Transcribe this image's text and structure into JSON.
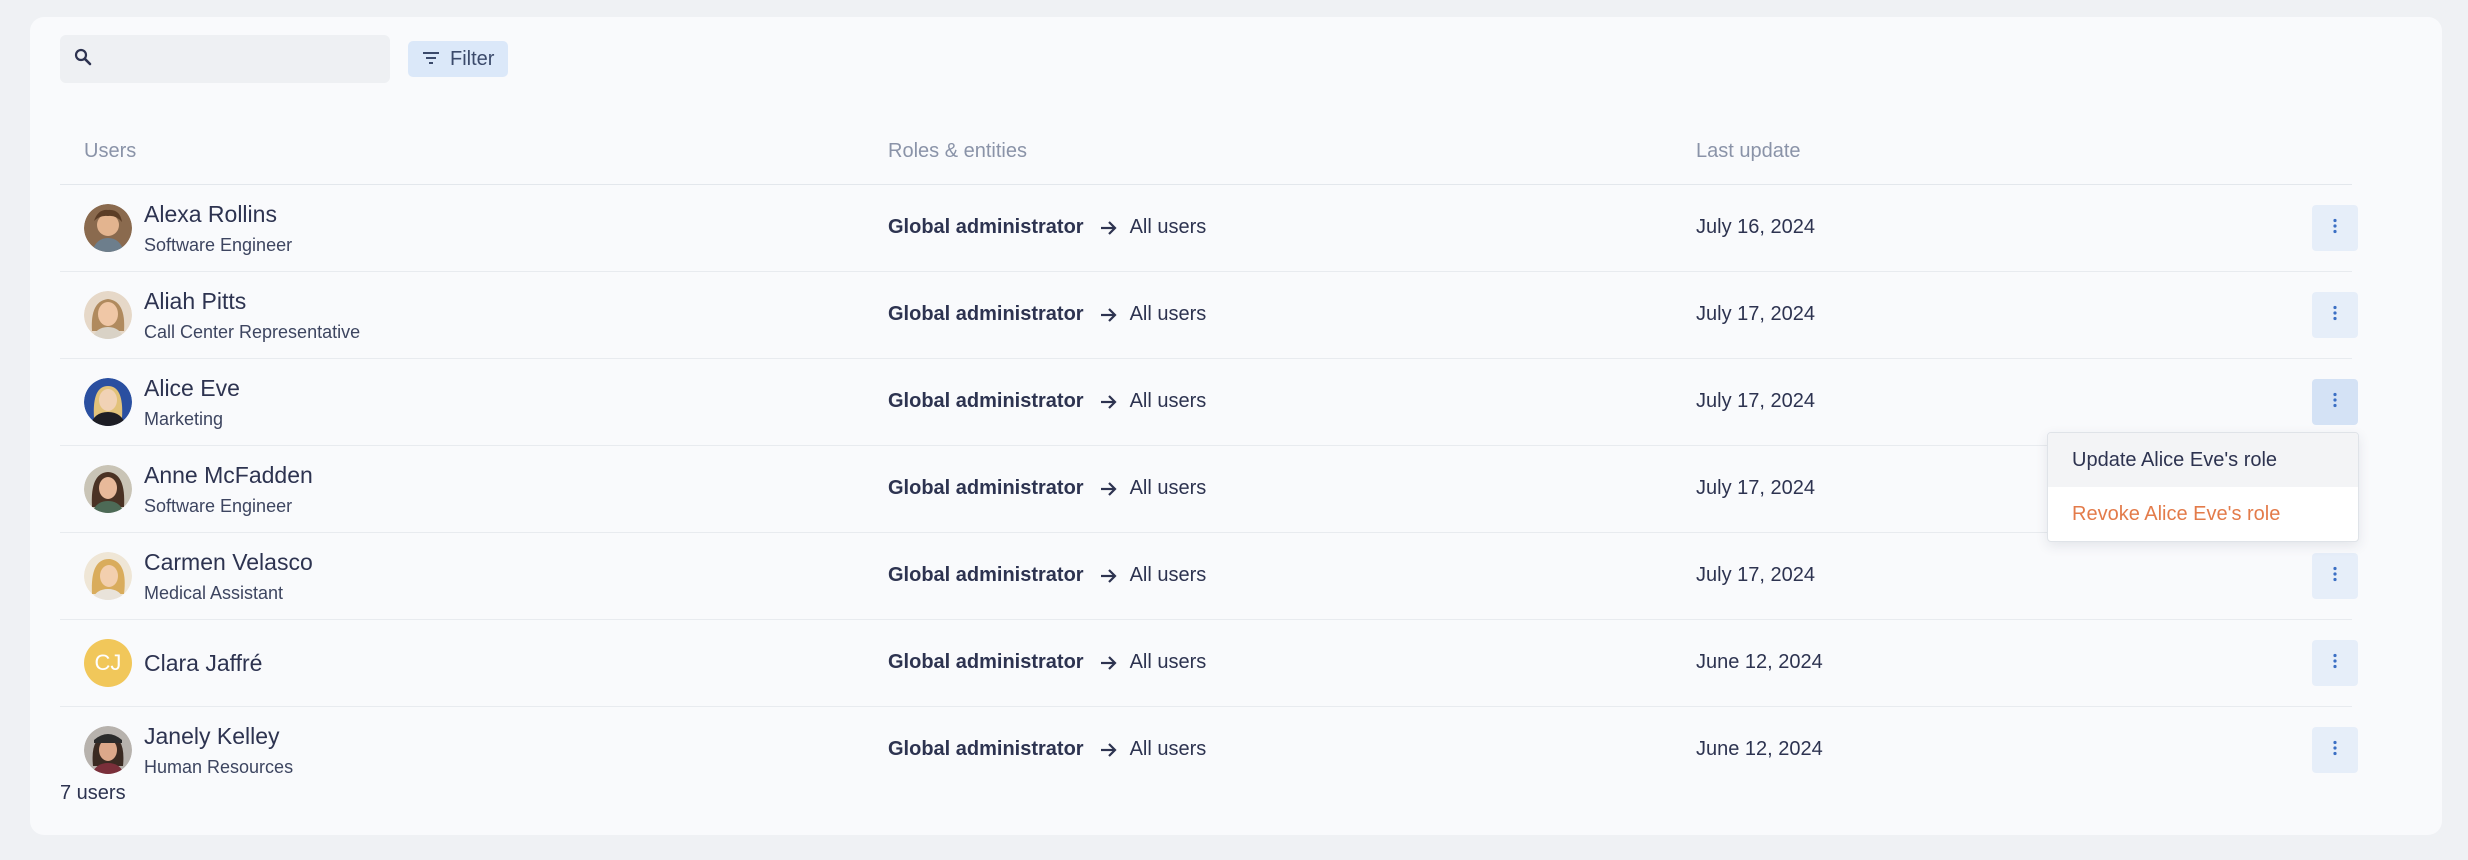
{
  "search": {
    "value": "",
    "placeholder": ""
  },
  "filter": {
    "label": "Filter"
  },
  "columns": {
    "users": "Users",
    "roles": "Roles & entities",
    "last_update": "Last update"
  },
  "rows": [
    {
      "name": "Alexa Rollins",
      "title": "Software Engineer",
      "role": "Global administrator",
      "entity": "All users",
      "date": "July 16, 2024",
      "avatar": "photo"
    },
    {
      "name": "Aliah Pitts",
      "title": "Call Center Representative",
      "role": "Global administrator",
      "entity": "All users",
      "date": "July 17, 2024",
      "avatar": "photo"
    },
    {
      "name": "Alice Eve",
      "title": "Marketing",
      "role": "Global administrator",
      "entity": "All users",
      "date": "July 17, 2024",
      "avatar": "photo"
    },
    {
      "name": "Anne McFadden",
      "title": "Software Engineer",
      "role": "Global administrator",
      "entity": "All users",
      "date": "July 17, 2024",
      "avatar": "photo"
    },
    {
      "name": "Carmen Velasco",
      "title": "Medical Assistant",
      "role": "Global administrator",
      "entity": "All users",
      "date": "July 17, 2024",
      "avatar": "photo"
    },
    {
      "name": "Clara Jaffré",
      "title": "",
      "initials": "CJ",
      "role": "Global administrator",
      "entity": "All users",
      "date": "June 12, 2024",
      "avatar": "initials"
    },
    {
      "name": "Janely Kelley",
      "title": "Human Resources",
      "role": "Global administrator",
      "entity": "All users",
      "date": "June 12, 2024",
      "avatar": "photo"
    }
  ],
  "menu": {
    "update": "Update Alice Eve's role",
    "revoke": "Revoke Alice Eve's role"
  },
  "footer": {
    "count": "7 users"
  },
  "colors": {
    "accent": "#dbe8f9",
    "revoke": "#e37b4a",
    "initials_bg": "#f1c75a"
  }
}
